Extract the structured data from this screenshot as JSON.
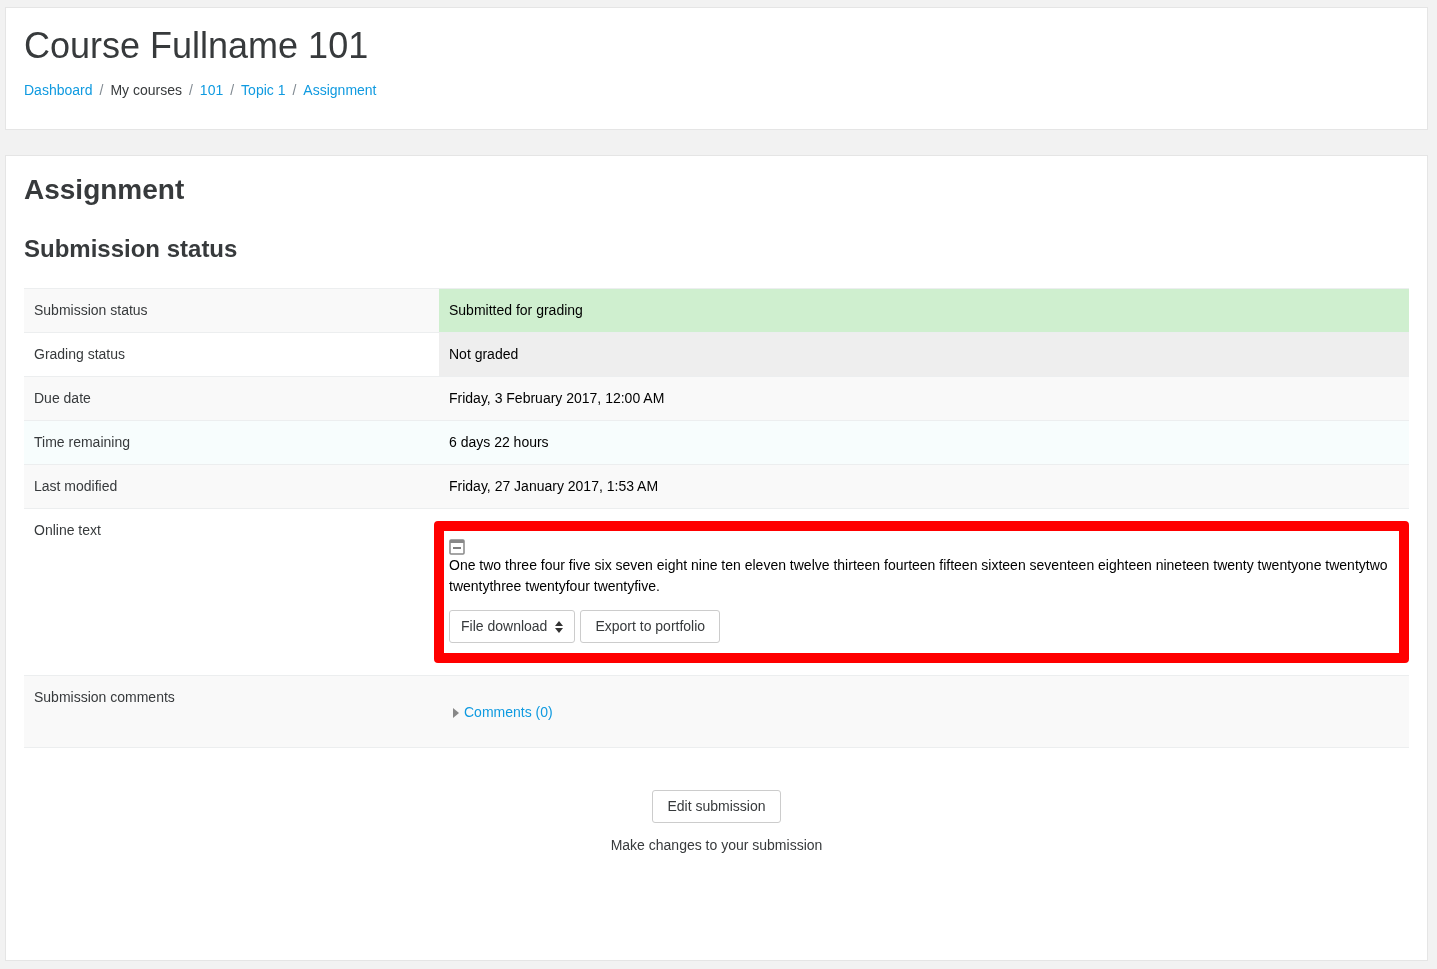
{
  "header": {
    "title": "Course Fullname 101",
    "separator": "/",
    "breadcrumb": [
      {
        "label": "Dashboard",
        "link": true
      },
      {
        "label": "My courses",
        "link": false
      },
      {
        "label": "101",
        "link": true
      },
      {
        "label": "Topic 1",
        "link": true
      },
      {
        "label": "Assignment",
        "link": true
      }
    ]
  },
  "page_title": "Assignment",
  "section_title": "Submission status",
  "rows": [
    {
      "kind": "text",
      "label": "Submission status",
      "value": "Submitted for grading",
      "color": "#cfefcf"
    },
    {
      "kind": "text",
      "label": "Grading status",
      "value": "Not graded",
      "color": "#eeeeee"
    },
    {
      "kind": "text",
      "label": "Due date",
      "value": "Friday, 3 February 2017, 12:00 AM"
    },
    {
      "kind": "text",
      "label": "Time remaining",
      "value": "6 days 22 hours",
      "color": "#f7fdfd",
      "full_row": true
    },
    {
      "kind": "text",
      "label": "Last modified",
      "value": "Friday, 27 January 2017, 1:53 AM"
    },
    {
      "kind": "online_text",
      "label": "Online text",
      "highlighted": true,
      "expanded": true,
      "text": "One two three four five six seven eight nine ten eleven twelve thirteen fourteen fifteen sixteen seventeen eighteen nineteen twenty twentyone twentytwo twentythree twentyfour twentyfive.",
      "select": "File download",
      "button": "Export to portfolio"
    },
    {
      "kind": "comments",
      "label": "Submission comments",
      "link": "Comments (0)",
      "expanded": false
    }
  ],
  "action": {
    "button": "Edit submission",
    "hint": "Make changes to your submission"
  }
}
